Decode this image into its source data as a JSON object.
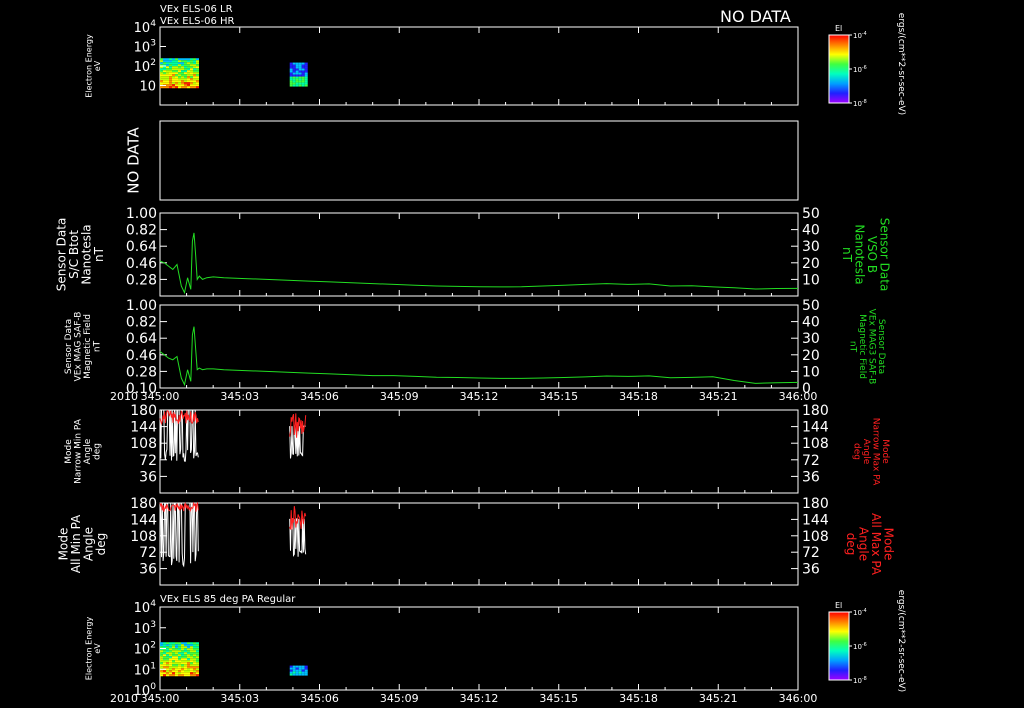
{
  "header": {
    "line1": "VEx ELS-06 LR",
    "line2": "VEx ELS-06 HR",
    "no_data_main": "NO DATA"
  },
  "colors": {
    "background": "#000000",
    "axes": "#ffffff",
    "mag_trace": "#22dd22",
    "min_pa_trace": "#ffffff",
    "max_pa_trace": "#ff2020",
    "right_label_green": "#22dd22",
    "right_label_red": "#ff2020"
  },
  "chart_data": [
    {
      "id": "panel1",
      "type": "heatmap",
      "title": "",
      "ylabel": "Electron Energy\neV",
      "yscale": "log",
      "ylim": [
        1,
        10000
      ],
      "yticks": [
        {
          "v": 10000,
          "base": "10",
          "exp": "4"
        },
        {
          "v": 1000,
          "base": "10",
          "exp": "3"
        },
        {
          "v": 100,
          "base": "10",
          "exp": "2"
        },
        {
          "v": 10,
          "base": "10",
          "exp": ""
        }
      ],
      "xlim": [
        0,
        60
      ],
      "segments": [
        {
          "x0": 0,
          "x1": 3.6,
          "e_lo": 8,
          "e_hi": 250
        },
        {
          "x0": 12.2,
          "x1": 13.7,
          "e_lo": 10,
          "e_hi": 150
        }
      ],
      "colorbar": {
        "label": "El",
        "units": "ergs/(cm**2-sr-sec-eV)",
        "ticks": [
          {
            "v": -4,
            "base": "10",
            "exp": "-4"
          },
          {
            "v": -6,
            "base": "10",
            "exp": "-6"
          },
          {
            "v": -8,
            "base": "10",
            "exp": "-8"
          }
        ],
        "range": [
          -8,
          -4
        ]
      }
    },
    {
      "id": "panel2",
      "type": "line",
      "ylabel": "NO DATA",
      "empty": true
    },
    {
      "id": "panel3",
      "type": "line",
      "ylabel": "Sensor Data\nS/C Btot\nNanotesla\nnT",
      "ylim": [
        0.1,
        1.0
      ],
      "yticks": [
        "1.00",
        "0.82",
        "0.64",
        "0.46",
        "0.28"
      ],
      "yticks_v": [
        1.0,
        0.82,
        0.64,
        0.46,
        0.28
      ],
      "y2label": "Sensor Data\nVSO B\nNanotesla\nnT",
      "y2lim": [
        0,
        50
      ],
      "y2ticks": [
        "50",
        "40",
        "30",
        "20",
        "10"
      ],
      "y2ticks_v": [
        50,
        40,
        30,
        20,
        10
      ],
      "xlim": [
        0,
        60
      ],
      "series": [
        {
          "x": [
            0,
            0.4,
            0.8,
            1.2,
            1.6,
            2.0,
            2.3,
            2.6,
            2.9,
            3.05,
            3.2,
            3.35,
            3.5,
            3.7,
            4.0,
            4.4,
            5,
            6,
            8,
            10,
            12,
            14,
            16,
            18,
            20,
            22,
            24,
            26,
            28,
            30,
            32,
            34,
            36,
            38,
            40,
            42,
            44,
            46,
            48,
            50,
            52,
            54,
            56,
            58,
            60
          ],
          "y": [
            21,
            20,
            18,
            16,
            19,
            6,
            2,
            11,
            4,
            33,
            38,
            25,
            10,
            12,
            10,
            11,
            11.5,
            11,
            10.5,
            10,
            9.5,
            9,
            8.5,
            8,
            7.5,
            7,
            6.5,
            6,
            5.8,
            5.6,
            5.5,
            5.6,
            6,
            6.5,
            7,
            7.5,
            7,
            7.3,
            6,
            6.2,
            5.5,
            5,
            4.2,
            4.5,
            4.6
          ]
        }
      ]
    },
    {
      "id": "panel4",
      "type": "line",
      "ylabel": "Sensor Data\nVEx MAG SAF-B\nMagnetic Field\nnT",
      "ylim": [
        0.1,
        1.0
      ],
      "yticks": [
        "1.00",
        "0.82",
        "0.64",
        "0.46",
        "0.28",
        "0.10"
      ],
      "yticks_v": [
        1.0,
        0.82,
        0.64,
        0.46,
        0.28,
        0.1
      ],
      "y2label": "Sensor Data\nVEx MAG3 SAF-B\nMagnetic Field\nnT",
      "y2lim": [
        0,
        50
      ],
      "y2ticks": [
        "50",
        "40",
        "30",
        "20",
        "10",
        "0"
      ],
      "y2ticks_v": [
        50,
        40,
        30,
        20,
        10,
        0
      ],
      "xlim": [
        0,
        60
      ],
      "xaxis": {
        "year": "2010",
        "ticks": [
          "345:00",
          "345:03",
          "345:06",
          "345:09",
          "345:12",
          "345:15",
          "345:18",
          "345:21",
          "346:00"
        ],
        "ticks_v": [
          0,
          7.5,
          15,
          22.5,
          30,
          37.5,
          45,
          52.5,
          60
        ]
      },
      "series": [
        {
          "x": [
            0,
            0.4,
            0.8,
            1.2,
            1.6,
            2.0,
            2.3,
            2.6,
            2.9,
            3.05,
            3.2,
            3.35,
            3.5,
            3.7,
            4.0,
            4.4,
            5,
            6,
            8,
            10,
            12,
            14,
            16,
            18,
            20,
            22,
            24,
            26,
            28,
            30,
            32,
            34,
            36,
            38,
            40,
            42,
            44,
            46,
            48,
            50,
            52,
            54,
            56,
            58,
            60
          ],
          "y": [
            22,
            20,
            18,
            17,
            19,
            6,
            2,
            11,
            4,
            32,
            37,
            24,
            11,
            12,
            11,
            11.5,
            11.5,
            11,
            10.5,
            10,
            9.5,
            9,
            8.5,
            8,
            7.5,
            7.5,
            7,
            6.5,
            6.3,
            6,
            5.8,
            5.8,
            6,
            6.3,
            6.7,
            7.2,
            7,
            7.3,
            6.2,
            6.4,
            6.8,
            4.5,
            2.8,
            3.2,
            3.4
          ]
        }
      ]
    },
    {
      "id": "panel5",
      "type": "line",
      "ylabel": "Mode\nNarrow Min PA\nAngle\ndeg",
      "ylim": [
        0,
        180
      ],
      "yticks": [
        "180",
        "144",
        "108",
        "72",
        "36"
      ],
      "yticks_v": [
        180,
        144,
        108,
        72,
        36
      ],
      "y2label": "Mode\nNarrow Max PA\nAngle\ndeg",
      "y2ticks": [
        "180",
        "144",
        "108",
        "72",
        "36"
      ],
      "y2ticks_v": [
        180,
        144,
        108,
        72,
        36
      ],
      "xlim": [
        0,
        60
      ],
      "series": [
        {
          "name": "min",
          "segments": [
            {
              "x0": 0.0,
              "x1": 3.6,
              "lo": 40,
              "hi": 180
            },
            {
              "x0": 12.2,
              "x1": 13.7,
              "lo": 55,
              "hi": 145
            }
          ]
        },
        {
          "name": "max",
          "segments": [
            {
              "x0": 0.0,
              "x1": 3.6,
              "lo": 150,
              "hi": 180
            },
            {
              "x0": 12.2,
              "x1": 13.7,
              "lo": 120,
              "hi": 180
            }
          ]
        }
      ]
    },
    {
      "id": "panel6",
      "type": "line",
      "ylabel": "Mode\nAll Min PA\nAngle\ndeg",
      "ylim": [
        0,
        180
      ],
      "yticks": [
        "180",
        "144",
        "108",
        "72",
        "36"
      ],
      "yticks_v": [
        180,
        144,
        108,
        72,
        36
      ],
      "y2label": "Mode\nAll Max PA\nAngle\ndeg",
      "y2ticks": [
        "180",
        "144",
        "108",
        "72",
        "36"
      ],
      "y2ticks_v": [
        180,
        144,
        108,
        72,
        36
      ],
      "xlim": [
        0,
        60
      ],
      "series": [
        {
          "name": "min",
          "segments": [
            {
              "x0": 0.0,
              "x1": 3.6,
              "lo": 5,
              "hi": 180
            },
            {
              "x0": 12.2,
              "x1": 13.7,
              "lo": 40,
              "hi": 145
            }
          ]
        },
        {
          "name": "max",
          "segments": [
            {
              "x0": 0.0,
              "x1": 3.6,
              "lo": 160,
              "hi": 180
            },
            {
              "x0": 12.2,
              "x1": 13.7,
              "lo": 120,
              "hi": 175
            }
          ]
        }
      ]
    },
    {
      "id": "panel7",
      "type": "heatmap",
      "title": "VEx ELS 85 deg PA Regular",
      "ylabel": "Electron Energy\neV",
      "yscale": "log",
      "ylim": [
        1,
        10000
      ],
      "yticks": [
        {
          "v": 10000,
          "base": "10",
          "exp": "4"
        },
        {
          "v": 1000,
          "base": "10",
          "exp": "3"
        },
        {
          "v": 100,
          "base": "10",
          "exp": "2"
        },
        {
          "v": 10,
          "base": "10",
          "exp": "1"
        },
        {
          "v": 1,
          "base": "10",
          "exp": "0"
        }
      ],
      "xlim": [
        0,
        60
      ],
      "xaxis": {
        "year": "2010",
        "ticks": [
          "345:00",
          "345:03",
          "345:06",
          "345:09",
          "345:12",
          "345:15",
          "345:18",
          "345:21",
          "346:00"
        ],
        "ticks_v": [
          0,
          7.5,
          15,
          22.5,
          30,
          37.5,
          45,
          52.5,
          60
        ]
      },
      "segments": [
        {
          "x0": 0,
          "x1": 3.6,
          "e_lo": 5,
          "e_hi": 200
        },
        {
          "x0": 12.2,
          "x1": 13.7,
          "e_lo": 5,
          "e_hi": 15
        }
      ],
      "colorbar": {
        "label": "El",
        "units": "ergs/(cm**2-sr-sec-eV)",
        "ticks": [
          {
            "v": -4,
            "base": "10",
            "exp": "-4"
          },
          {
            "v": -6,
            "base": "10",
            "exp": "-6"
          },
          {
            "v": -8,
            "base": "10",
            "exp": "-8"
          }
        ],
        "range": [
          -8,
          -4
        ]
      }
    }
  ]
}
